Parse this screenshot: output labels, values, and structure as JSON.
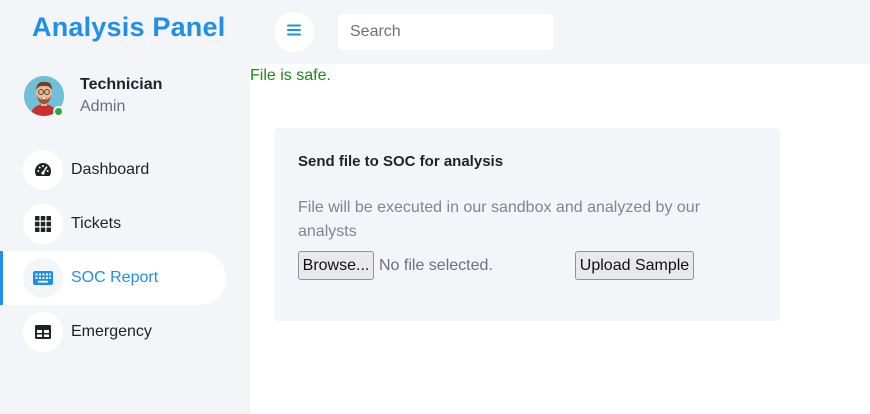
{
  "app": {
    "title": "Analysis Panel",
    "accent_color": "#1e90ea",
    "success_color": "#1a8a1a"
  },
  "profile": {
    "name": "Technician",
    "role": "Admin",
    "status": "online"
  },
  "sidebar": {
    "items": [
      {
        "label": "Dashboard",
        "icon": "speedometer-icon",
        "active": false
      },
      {
        "label": "Tickets",
        "icon": "grid-icon",
        "active": false
      },
      {
        "label": "SOC Report",
        "icon": "keyboard-icon",
        "active": true
      },
      {
        "label": "Emergency",
        "icon": "table-icon",
        "active": false
      }
    ]
  },
  "topbar": {
    "menu_icon": "hamburger-menu-icon",
    "search_placeholder": "Search"
  },
  "main": {
    "status_message": "File is safe.",
    "card": {
      "title": "Send file to SOC for analysis",
      "description": "File will be executed in our sandbox and analyzed by our analysts",
      "browse_label": "Browse...",
      "file_status": "No file selected.",
      "upload_label": "Upload Sample"
    }
  }
}
